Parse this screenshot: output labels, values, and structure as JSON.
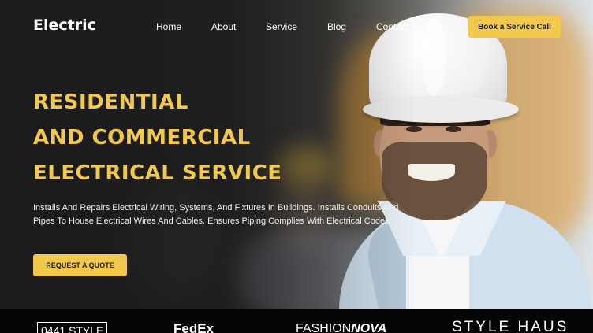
{
  "header": {
    "logo": "Electric",
    "nav": [
      "Home",
      "About",
      "Service",
      "Blog",
      "Contact"
    ],
    "cta_label": "Book a Service Call"
  },
  "hero": {
    "headline_lines": [
      "RESIDENTIAL",
      "AND COMMERCIAL",
      "ELECTRICAL SERVICE"
    ],
    "description": "Installs And Repairs Electrical Wiring, Systems, And Fixtures In Buildings. Installs Conduits And Pipes To House Electrical Wires And Cables. Ensures Piping Complies With Electrical Codes.",
    "button_label": "REQUEST A QUOTE",
    "image": "smiling electrician in white hard hat and light blue shirt, blurred construction site behind"
  },
  "brands": {
    "b1": "0441 STYLE",
    "b2": "FedEx",
    "b3_light": "FASHION",
    "b3_bold": "NOVA",
    "b4": "STYLE HAUS"
  },
  "colors": {
    "accent": "#f2c94c",
    "background": "#1e1e1e",
    "text": "#ffffff",
    "strip": "#050505"
  }
}
